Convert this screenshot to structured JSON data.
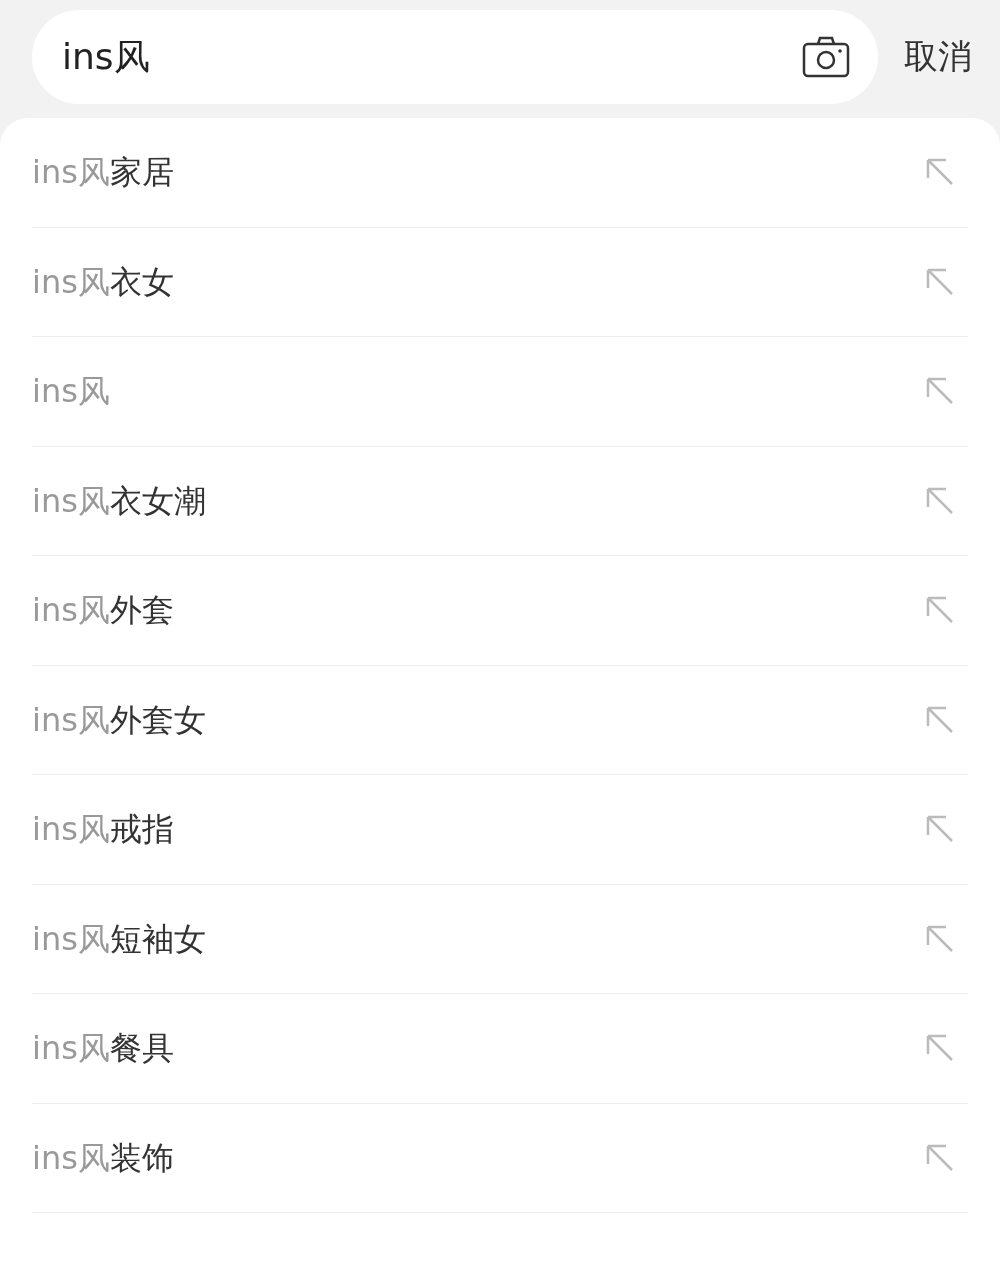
{
  "search": {
    "value": "ins风"
  },
  "cancel": "取消",
  "suggestions": [
    {
      "match": "ins风",
      "rest": "家居"
    },
    {
      "match": "ins风",
      "rest": "衣女"
    },
    {
      "match": "ins风"
    },
    {
      "match": "ins风",
      "rest": "衣女潮"
    },
    {
      "match": "ins风",
      "rest": "外套"
    },
    {
      "match": "ins风",
      "rest": "外套女"
    },
    {
      "match": "ins风",
      "rest": "戒指"
    },
    {
      "match": "ins风",
      "rest": "短袖女"
    },
    {
      "match": "ins风",
      "rest": "餐具"
    },
    {
      "match": "ins风",
      "rest": "装饰"
    }
  ]
}
